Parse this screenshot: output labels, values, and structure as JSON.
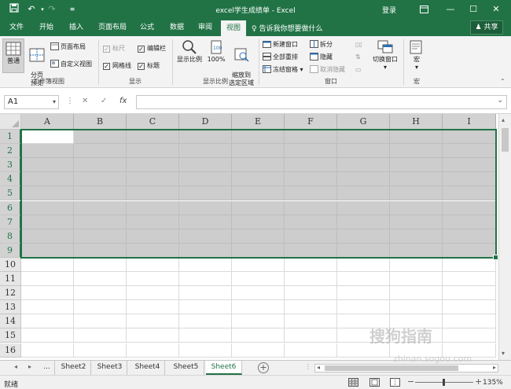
{
  "titlebar": {
    "title": "excel学生成绩单 - Excel",
    "login": "登录",
    "save_icon": "save-icon",
    "undo_icon": "undo-icon",
    "redo_icon": "redo-icon"
  },
  "tabs": [
    {
      "label": "文件"
    },
    {
      "label": "开始"
    },
    {
      "label": "插入"
    },
    {
      "label": "页面布局"
    },
    {
      "label": "公式"
    },
    {
      "label": "数据"
    },
    {
      "label": "审阅"
    },
    {
      "label": "视图",
      "active": true
    }
  ],
  "tellme": "♀ 告诉我你想要做什么",
  "share": "♟ 共享",
  "ribbon": {
    "workbook_views": {
      "label": "工作簿视图",
      "normal": "普通",
      "page_break": "分页\n预览",
      "page_layout": "页面布局",
      "custom_views": "自定义视图"
    },
    "show": {
      "label": "显示",
      "ruler": "标尺",
      "formula_bar": "编辑栏",
      "gridlines": "网格线",
      "headings": "标题"
    },
    "zoom": {
      "label": "显示比例",
      "zoom": "显示比例",
      "hundred": "100%",
      "zoom_selection": "缩放到\n选定区域"
    },
    "window": {
      "label": "窗口",
      "new_window": "新建窗口",
      "arrange_all": "全部重排",
      "freeze_panes": "冻结窗格",
      "split": "拆分",
      "hide": "隐藏",
      "unhide": "取消隐藏",
      "switch_windows": "切换窗口"
    },
    "macros": {
      "label": "宏",
      "macros": "宏"
    }
  },
  "formula_bar": {
    "name_box": "A1",
    "cancel": "✕",
    "enter": "✓",
    "fx": "fx",
    "value": ""
  },
  "grid": {
    "columns": [
      "A",
      "B",
      "C",
      "D",
      "E",
      "F",
      "G",
      "H",
      "I"
    ],
    "rows": [
      "1",
      "2",
      "3",
      "4",
      "5",
      "6",
      "7",
      "8",
      "9",
      "10",
      "11",
      "12",
      "13",
      "14",
      "15",
      "16"
    ],
    "selected_range": "A1:I9"
  },
  "sheets": {
    "nav_left": "◂",
    "nav_right": "▸",
    "ellipsis": "...",
    "tabs": [
      "Sheet2",
      "Sheet3",
      "Sheet4",
      "Sheet5",
      "Sheet6"
    ],
    "active": "Sheet6",
    "add": "+"
  },
  "statusbar": {
    "status": "就绪",
    "zoom": "135%"
  },
  "watermark": {
    "line1": "搜狗指南",
    "line2": "zhinan.sogou.com"
  }
}
